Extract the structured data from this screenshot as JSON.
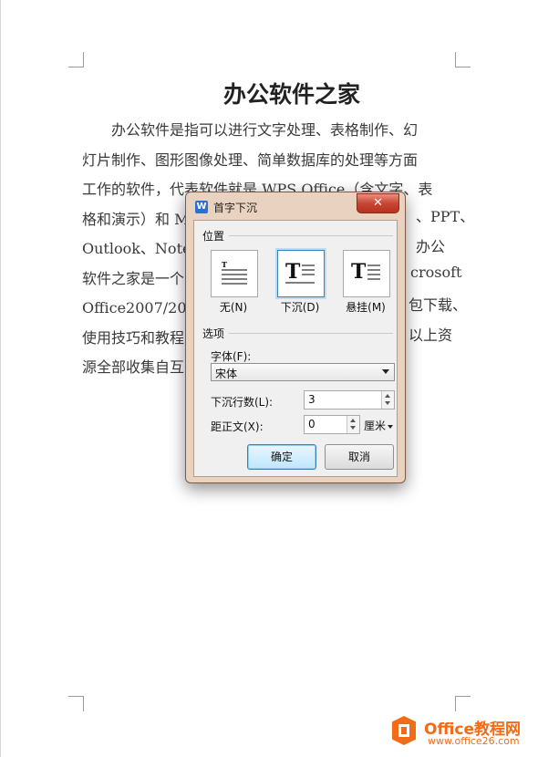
{
  "document": {
    "title": "办公软件之家",
    "lines": [
      "　　办公软件是指可以进行文字处理、表格制作、幻",
      "灯片制作、图形图像处理、简单数据库的处理等方面",
      "工作的软件，代表软件就是 WPS Office（含文字、表",
      "格和演示）和 M",
      "Outlook、Note-",
      "软件之家是一个",
      "Office2007/201",
      "使用技巧和教程",
      "源全部收集自互"
    ],
    "right_fragments": [
      "、PPT、",
      "办公",
      "crosoft",
      "包下载、",
      "以上资"
    ]
  },
  "dialog": {
    "title": "首字下沉",
    "close_glyph": "✕",
    "position_section": "位置",
    "position_options": [
      {
        "label": "无(N)"
      },
      {
        "label": "下沉(D)"
      },
      {
        "label": "悬挂(M)"
      }
    ],
    "selected_position": "下沉(D)",
    "options_section": "选项",
    "font_label": "字体(F):",
    "font_value": "宋体",
    "lines_label": "下沉行数(L):",
    "lines_value": "3",
    "distance_label": "距正文(X):",
    "distance_value": "0",
    "unit": "厘米",
    "ok": "确定",
    "cancel": "取消"
  },
  "watermark": {
    "brand": "Office教程网",
    "url": "www.office26.com"
  }
}
